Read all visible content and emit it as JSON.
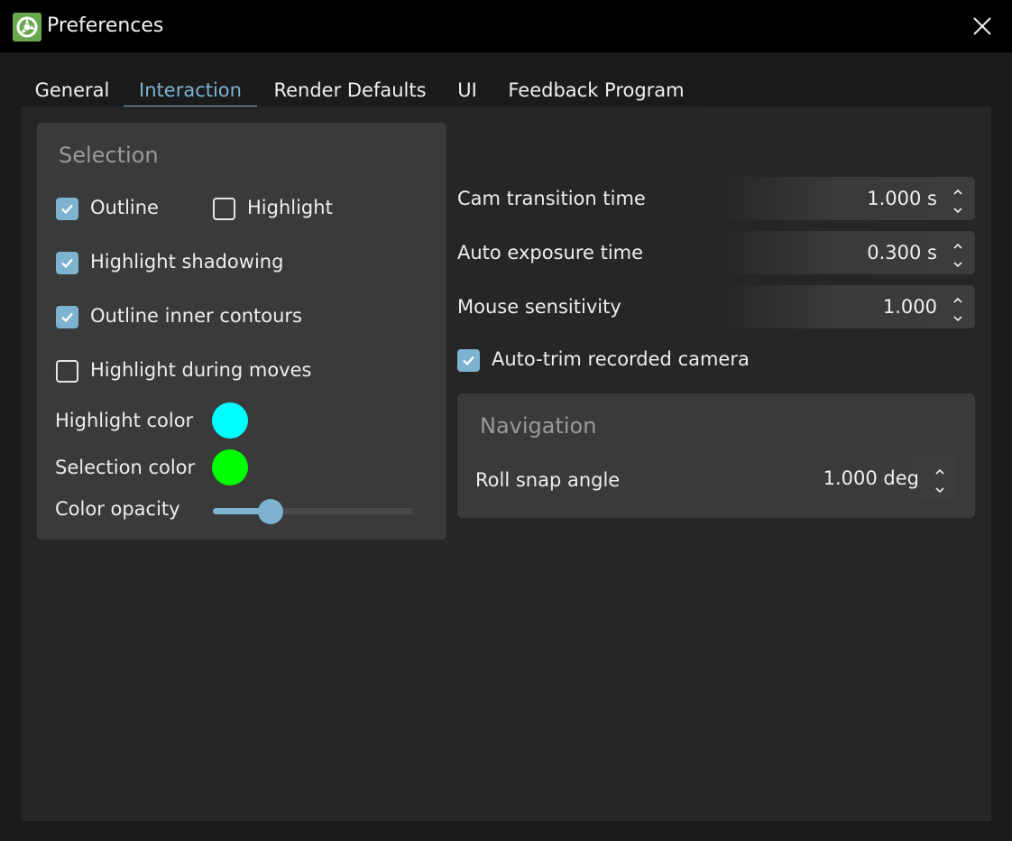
{
  "window": {
    "title": "Preferences"
  },
  "tabs": [
    {
      "label": "General",
      "active": false
    },
    {
      "label": "Interaction",
      "active": true
    },
    {
      "label": "Render Defaults",
      "active": false
    },
    {
      "label": "UI",
      "active": false
    },
    {
      "label": "Feedback Program",
      "active": false
    }
  ],
  "selection": {
    "title": "Selection",
    "outline": {
      "label": "Outline",
      "checked": true
    },
    "highlight": {
      "label": "Highlight",
      "checked": false
    },
    "highlight_shadowing": {
      "label": "Highlight shadowing",
      "checked": true
    },
    "outline_inner_contours": {
      "label": "Outline inner contours",
      "checked": true
    },
    "highlight_during_moves": {
      "label": "Highlight during moves",
      "checked": false
    },
    "highlight_color": {
      "label": "Highlight color",
      "color": "#00ffff"
    },
    "selection_color": {
      "label": "Selection color",
      "color": "#00ff00"
    },
    "color_opacity": {
      "label": "Color opacity",
      "value": 0.29
    }
  },
  "camera": {
    "cam_transition_time": {
      "label": "Cam transition time",
      "value": "1.000 s"
    },
    "auto_exposure_time": {
      "label": "Auto exposure time",
      "value": "0.300 s"
    },
    "mouse_sensitivity": {
      "label": "Mouse sensitivity",
      "value": "1.000"
    },
    "auto_trim": {
      "label": "Auto-trim recorded camera",
      "checked": true
    }
  },
  "navigation": {
    "title": "Navigation",
    "roll_snap_angle": {
      "label": "Roll snap angle",
      "value": "1.000 deg"
    }
  },
  "colors": {
    "accent": "#7db3d1",
    "app_icon": "#6aa84f"
  },
  "icons": {
    "app": "app-logo-icon",
    "close": "close-icon",
    "check": "checkmark-icon",
    "spin_up": "chevron-up-icon",
    "spin_down": "chevron-down-icon"
  }
}
